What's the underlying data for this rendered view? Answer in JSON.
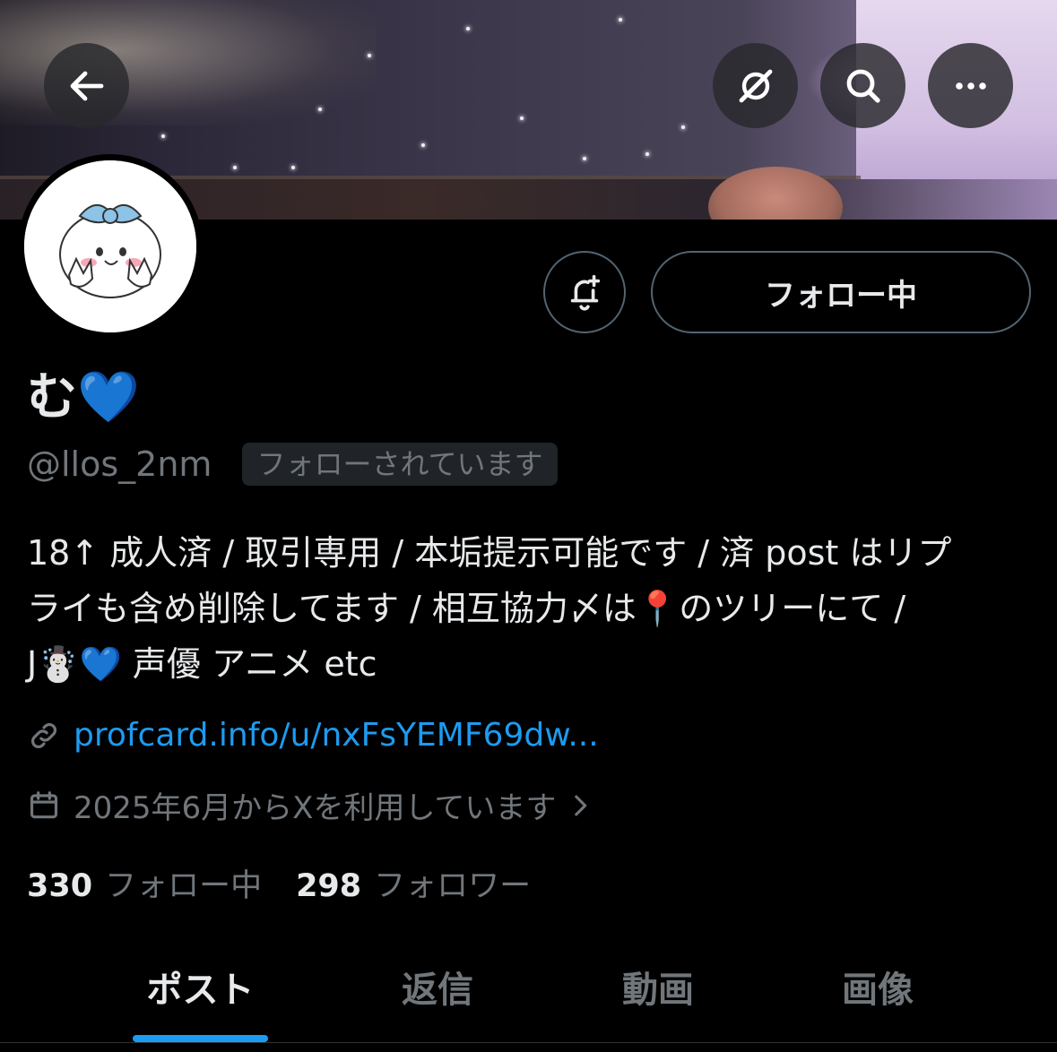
{
  "nav": {
    "back_icon": "arrow-left-icon",
    "grok_icon": "grok-icon",
    "search_icon": "search-icon",
    "more_icon": "more-horizontal-icon"
  },
  "actions": {
    "notify_icon": "bell-plus-icon",
    "follow_label": "フォロー中"
  },
  "profile": {
    "display_name": "む💙",
    "handle": "@llos_2nm",
    "follows_you": "フォローされています",
    "bio_lines": [
      "18↑ 成人済 / 取引専用 / 本垢提示可能です / 済 post はリプ",
      "ライも含め削除してます / 相互協力〆は📍のツリーにて /",
      "J☃️💙 声優 アニメ etc"
    ],
    "link": "profcard.info/u/nxFsYEMF69dw...",
    "joined": "2025年6月からXを利用しています",
    "following_count": "330",
    "following_label": "フォロー中",
    "followers_count": "298",
    "followers_label": "フォロワー"
  },
  "tabs": [
    {
      "label": "ポスト",
      "active": true
    },
    {
      "label": "返信",
      "active": false
    },
    {
      "label": "動画",
      "active": false
    },
    {
      "label": "画像",
      "active": false
    }
  ],
  "colors": {
    "accent": "#1d9bf0",
    "muted": "#71767b",
    "text": "#e7e9ea",
    "background": "#000000"
  }
}
